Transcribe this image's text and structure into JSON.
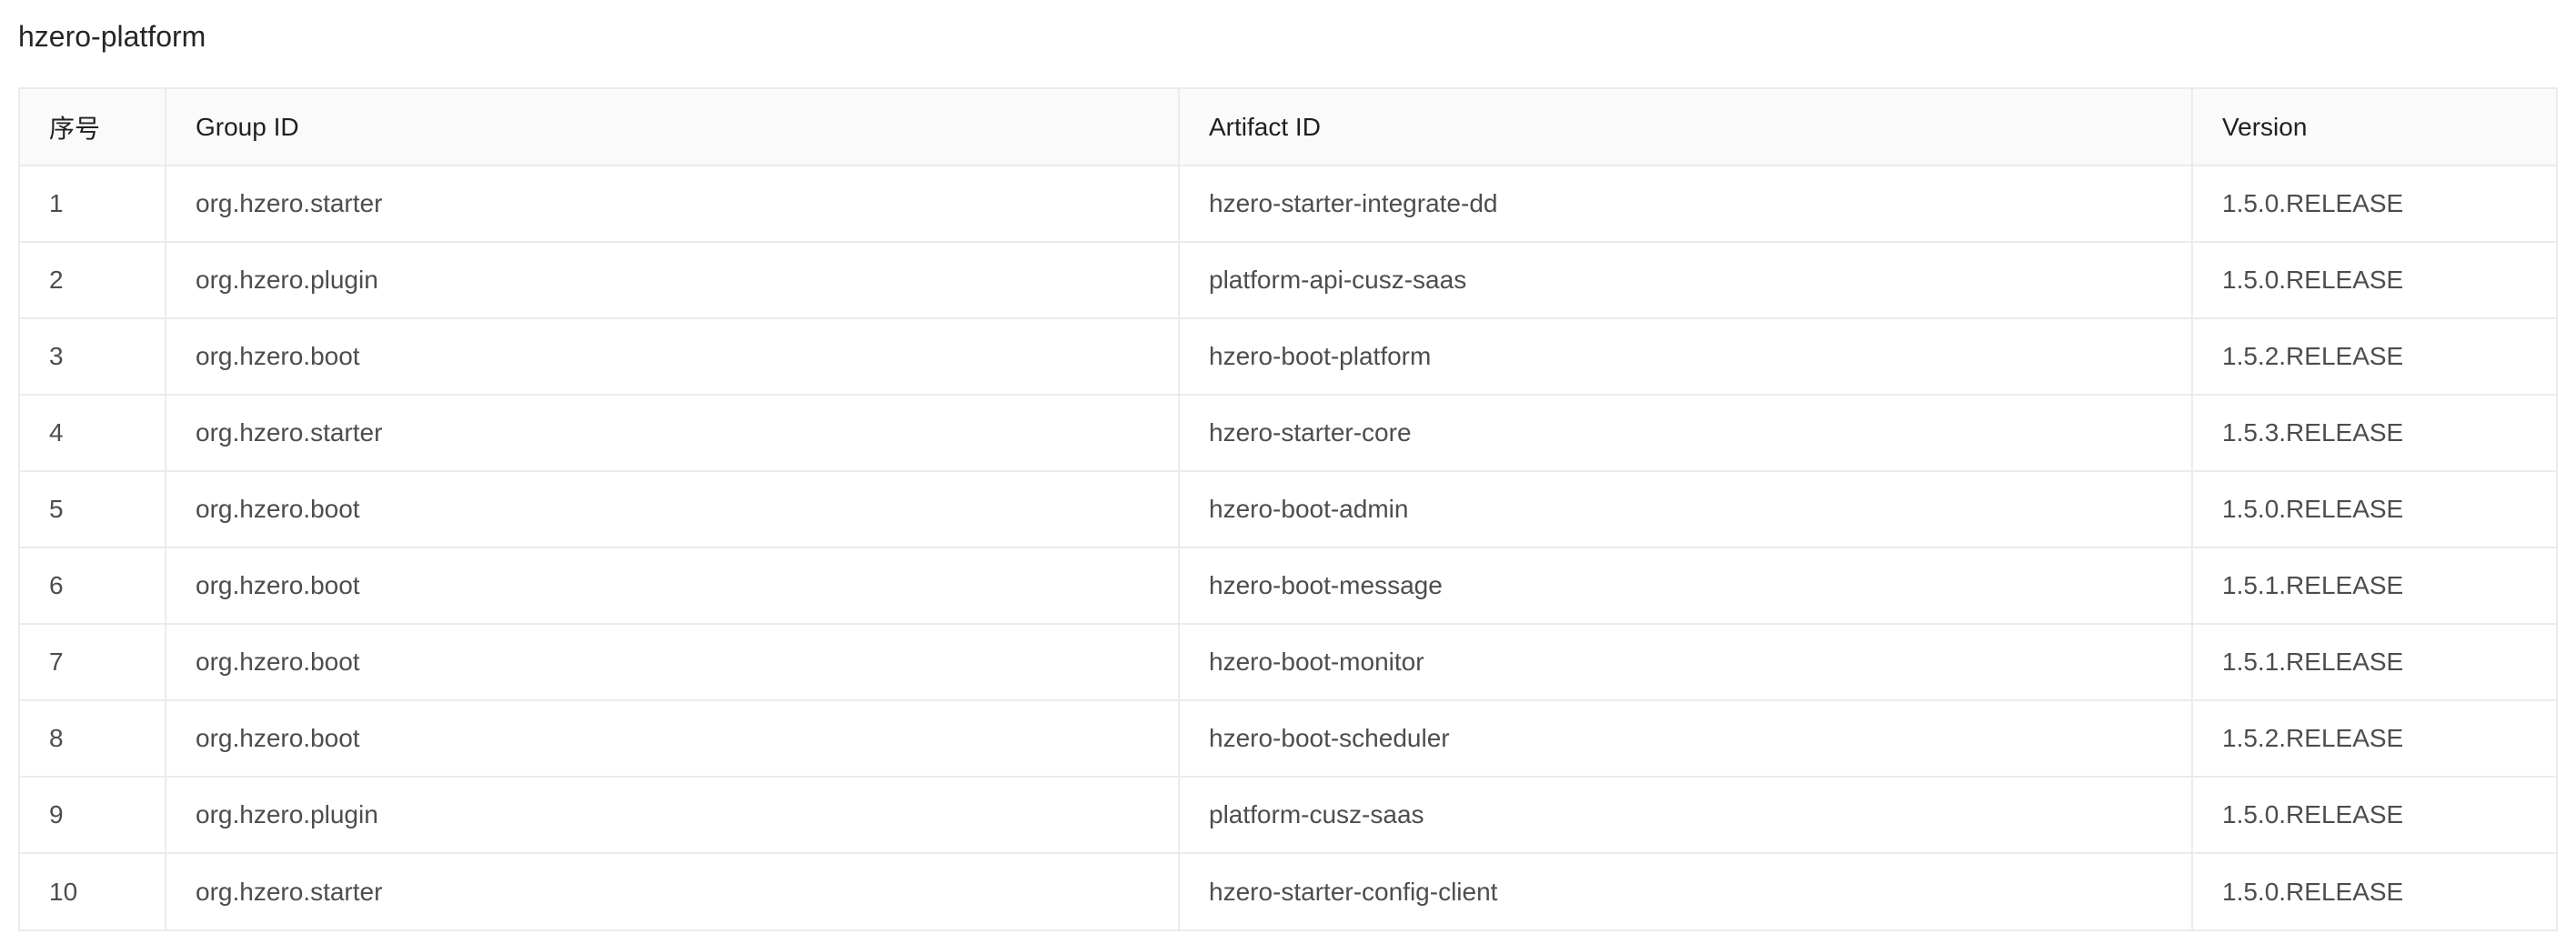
{
  "section": {
    "title": "hzero-platform"
  },
  "table": {
    "headers": {
      "index": "序号",
      "group_id": "Group ID",
      "artifact_id": "Artifact ID",
      "version": "Version"
    },
    "rows": [
      {
        "index": "1",
        "group_id": "org.hzero.starter",
        "artifact_id": "hzero-starter-integrate-dd",
        "version": "1.5.0.RELEASE"
      },
      {
        "index": "2",
        "group_id": "org.hzero.plugin",
        "artifact_id": "platform-api-cusz-saas",
        "version": "1.5.0.RELEASE"
      },
      {
        "index": "3",
        "group_id": "org.hzero.boot",
        "artifact_id": "hzero-boot-platform",
        "version": "1.5.2.RELEASE"
      },
      {
        "index": "4",
        "group_id": "org.hzero.starter",
        "artifact_id": "hzero-starter-core",
        "version": "1.5.3.RELEASE"
      },
      {
        "index": "5",
        "group_id": "org.hzero.boot",
        "artifact_id": "hzero-boot-admin",
        "version": "1.5.0.RELEASE"
      },
      {
        "index": "6",
        "group_id": "org.hzero.boot",
        "artifact_id": "hzero-boot-message",
        "version": "1.5.1.RELEASE"
      },
      {
        "index": "7",
        "group_id": "org.hzero.boot",
        "artifact_id": "hzero-boot-monitor",
        "version": "1.5.1.RELEASE"
      },
      {
        "index": "8",
        "group_id": "org.hzero.boot",
        "artifact_id": "hzero-boot-scheduler",
        "version": "1.5.2.RELEASE"
      },
      {
        "index": "9",
        "group_id": "org.hzero.plugin",
        "artifact_id": "platform-cusz-saas",
        "version": "1.5.0.RELEASE"
      },
      {
        "index": "10",
        "group_id": "org.hzero.starter",
        "artifact_id": "hzero-starter-config-client",
        "version": "1.5.0.RELEASE"
      }
    ]
  }
}
